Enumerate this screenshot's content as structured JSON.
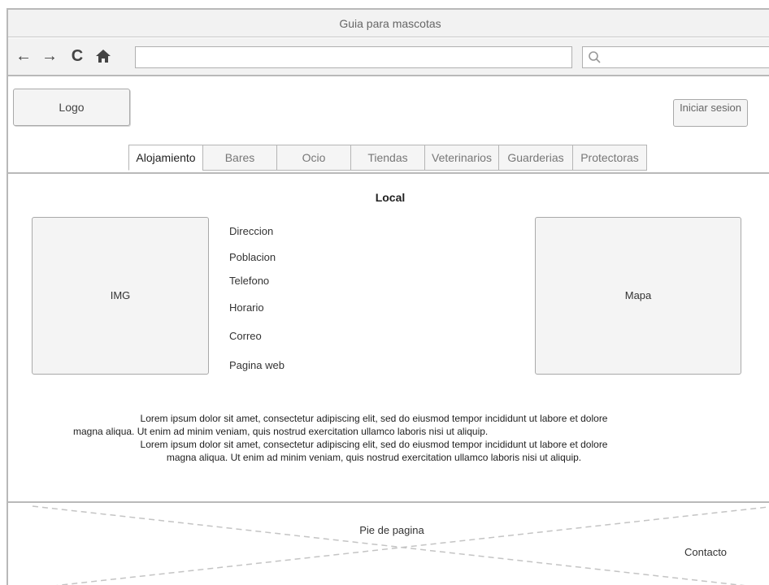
{
  "window": {
    "title": "Guia para mascotas"
  },
  "toolbar": {
    "address_value": "",
    "search_value": ""
  },
  "header": {
    "logo": "Logo",
    "login": "Iniciar sesion",
    "tabs": [
      "Alojamiento",
      "Bares",
      "Ocio",
      "Tiendas",
      "Veterinarios",
      "Guarderias",
      "Protectoras"
    ]
  },
  "content": {
    "title": "Local",
    "image_label": "IMG",
    "map_label": "Mapa",
    "info": [
      "Direccion",
      "Poblacion",
      "Telefono",
      "Horario",
      "Correo",
      "Pagina web"
    ],
    "lorem": [
      "Lorem ipsum dolor sit amet, consectetur adipiscing elit, sed do eiusmod tempor incididunt ut labore et dolore",
      "magna aliqua. Ut enim ad minim veniam, quis nostrud exercitation ullamco laboris nisi ut aliquip.",
      "Lorem ipsum dolor sit amet, consectetur adipiscing elit, sed do eiusmod tempor incididunt ut labore et dolore",
      "magna aliqua. Ut enim ad minim veniam, quis nostrud exercitation ullamco laboris nisi ut aliquip."
    ]
  },
  "footer": {
    "label": "Pie de pagina",
    "contact": "Contacto"
  },
  "icons": {
    "back": "arrow-left-icon",
    "forward": "arrow-right-icon",
    "reload": "reload-icon",
    "home": "home-icon",
    "search": "search-icon"
  }
}
